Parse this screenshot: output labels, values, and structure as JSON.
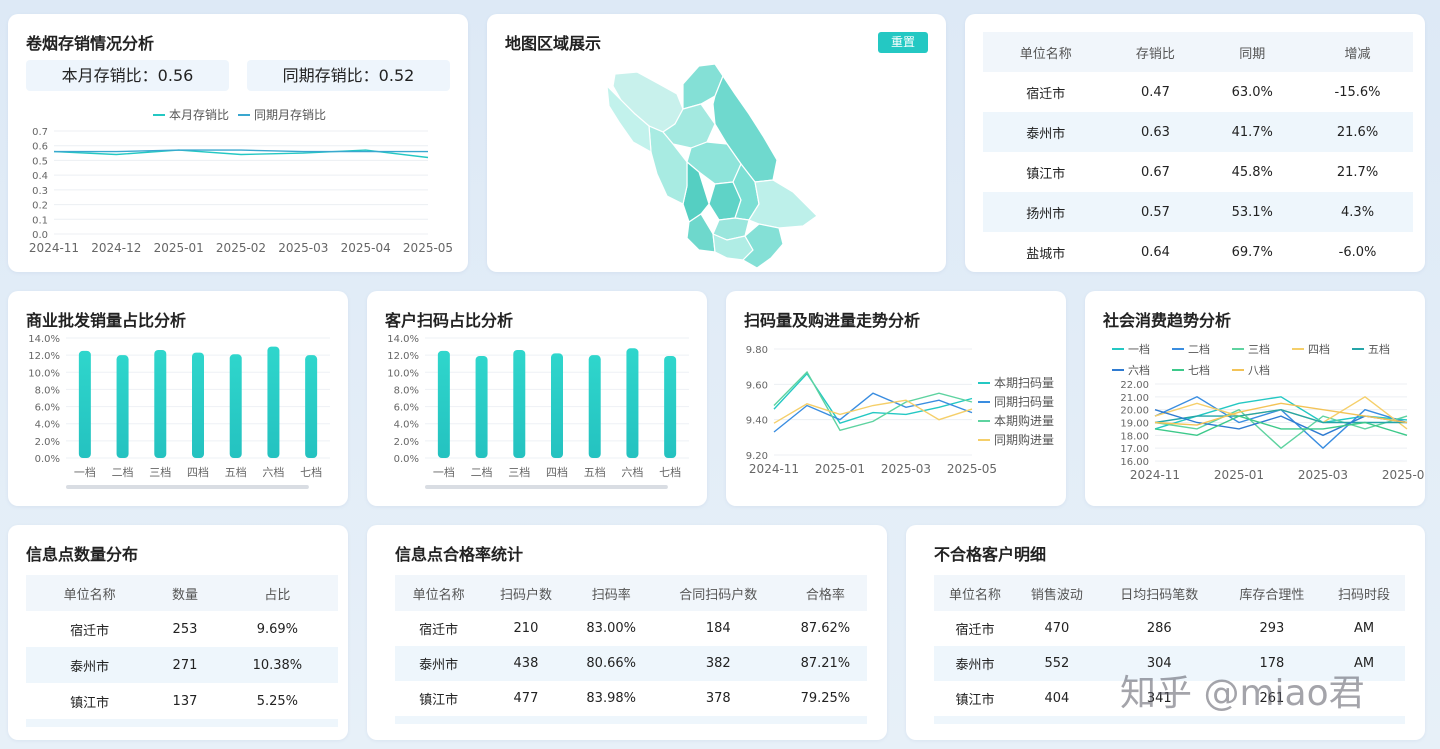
{
  "card1": {
    "title": "卷烟存销情况分析",
    "stat1": "本月存销比：0.56",
    "stat2": "同期存销比：0.52"
  },
  "card2": {
    "title": "地图区域展示",
    "reset": "重置"
  },
  "table_top": {
    "headers": [
      "单位名称",
      "存销比",
      "同期",
      "增减"
    ],
    "rows": [
      [
        "宿迁市",
        "0.47",
        "63.0%",
        "-15.6%"
      ],
      [
        "泰州市",
        "0.63",
        "41.7%",
        "21.6%"
      ],
      [
        "镇江市",
        "0.67",
        "45.8%",
        "21.7%"
      ],
      [
        "扬州市",
        "0.57",
        "53.1%",
        "4.3%"
      ],
      [
        "盐城市",
        "0.64",
        "69.7%",
        "-6.0%"
      ]
    ]
  },
  "card4": {
    "title": "商业批发销量占比分析"
  },
  "card5": {
    "title": "客户扫码占比分析"
  },
  "card6": {
    "title": "扫码量及购进量走势分析"
  },
  "card7": {
    "title": "社会消费趋势分析"
  },
  "card8": {
    "title": "信息点数量分布",
    "headers": [
      "单位名称",
      "数量",
      "占比"
    ],
    "rows": [
      [
        "宿迁市",
        "253",
        "9.69%"
      ],
      [
        "泰州市",
        "271",
        "10.38%"
      ],
      [
        "镇江市",
        "137",
        "5.25%"
      ]
    ]
  },
  "card9": {
    "title": "信息点合格率统计",
    "headers": [
      "单位名称",
      "扫码户数",
      "扫码率",
      "合同扫码户数",
      "合格率"
    ],
    "rows": [
      [
        "宿迁市",
        "210",
        "83.00%",
        "184",
        "87.62%"
      ],
      [
        "泰州市",
        "438",
        "80.66%",
        "382",
        "87.21%"
      ],
      [
        "镇江市",
        "477",
        "83.98%",
        "378",
        "79.25%"
      ]
    ]
  },
  "card10": {
    "title": "不合格客户明细",
    "headers": [
      "单位名称",
      "销售波动",
      "日均扫码笔数",
      "库存合理性",
      "扫码时段"
    ],
    "rows": [
      [
        "宿迁市",
        "470",
        "286",
        "293",
        "AM"
      ],
      [
        "泰州市",
        "552",
        "304",
        "178",
        "AM"
      ],
      [
        "镇江市",
        "404",
        "341",
        "261",
        ""
      ]
    ]
  },
  "watermark": "知乎 @miao君",
  "colors": {
    "teal": "#24c8c3",
    "blue": "#3a8de0",
    "green": "#5ed3a0",
    "yellow": "#f5cf6a"
  },
  "chart_data": [
    {
      "type": "line",
      "x": [
        "2024-11",
        "2024-12",
        "2025-01",
        "2025-02",
        "2025-03",
        "2025-04",
        "2025-05"
      ],
      "series": [
        {
          "name": "本月存销比",
          "values": [
            0.56,
            0.54,
            0.57,
            0.54,
            0.55,
            0.57,
            0.52
          ]
        },
        {
          "name": "同期月存销比",
          "values": [
            0.56,
            0.56,
            0.57,
            0.57,
            0.56,
            0.56,
            0.56
          ]
        }
      ],
      "ylim": [
        0,
        0.7
      ],
      "yticks": [
        "0.7",
        "0.6",
        "0.5",
        "0.4",
        "0.3",
        "0.2",
        "0.1",
        "0.0"
      ]
    },
    {
      "type": "bar",
      "categories": [
        "一档",
        "二档",
        "三档",
        "四档",
        "五档",
        "六档",
        "七档"
      ],
      "values": [
        12.5,
        12.0,
        12.6,
        12.3,
        12.1,
        13.0,
        12.0
      ],
      "ylim": [
        0,
        14
      ],
      "yticks": [
        "14.0%",
        "12.0%",
        "10.0%",
        "8.0%",
        "6.0%",
        "4.0%",
        "2.0%",
        "0.0%"
      ]
    },
    {
      "type": "bar",
      "categories": [
        "一档",
        "二档",
        "三档",
        "四档",
        "五档",
        "六档",
        "七档"
      ],
      "values": [
        12.5,
        11.9,
        12.6,
        12.2,
        12.0,
        12.8,
        11.9
      ],
      "ylim": [
        0,
        14
      ],
      "yticks": [
        "14.0%",
        "12.0%",
        "10.0%",
        "8.0%",
        "6.0%",
        "4.0%",
        "2.0%",
        "0.0%"
      ]
    },
    {
      "type": "line",
      "xticks": [
        "2024-11",
        "2025-01",
        "2025-03",
        "2025-05"
      ],
      "ylim": [
        9.2,
        9.8
      ],
      "yticks": [
        "9.80",
        "9.60",
        "9.40",
        "9.20"
      ],
      "series": [
        {
          "name": "本期扫码量",
          "color": "#24c8c3",
          "values": [
            9.46,
            9.66,
            9.38,
            9.44,
            9.43,
            9.47,
            9.52
          ]
        },
        {
          "name": "同期扫码量",
          "color": "#3a8de0",
          "values": [
            9.33,
            9.48,
            9.4,
            9.55,
            9.47,
            9.51,
            9.44
          ]
        },
        {
          "name": "本期购进量",
          "color": "#5ed3a0",
          "values": [
            9.48,
            9.67,
            9.34,
            9.39,
            9.5,
            9.55,
            9.5
          ]
        },
        {
          "name": "同期购进量",
          "color": "#f5cf6a",
          "values": [
            9.38,
            9.49,
            9.43,
            9.48,
            9.51,
            9.4,
            9.46
          ]
        }
      ]
    },
    {
      "type": "line",
      "xticks": [
        "2024-11",
        "2025-01",
        "2025-03",
        "2025-05"
      ],
      "ylim": [
        16,
        22
      ],
      "yticks": [
        "22.00",
        "21.00",
        "20.00",
        "19.00",
        "18.00",
        "17.00",
        "16.00"
      ],
      "series": [
        {
          "name": "一档",
          "color": "#24c8c3",
          "values": [
            18.5,
            19.5,
            20.5,
            21.0,
            19.0,
            19.5,
            19.2
          ]
        },
        {
          "name": "二档",
          "color": "#3a8de0",
          "values": [
            19.5,
            21.0,
            19.0,
            20.0,
            17.0,
            20.0,
            19.0
          ]
        },
        {
          "name": "三档",
          "color": "#5ed3a0",
          "values": [
            19.0,
            18.5,
            20.0,
            17.0,
            19.5,
            18.5,
            19.5
          ]
        },
        {
          "name": "四档",
          "color": "#f5cf6a",
          "values": [
            19.5,
            20.5,
            19.5,
            20.0,
            19.0,
            21.0,
            18.5
          ]
        },
        {
          "name": "五档",
          "color": "#24a5a8",
          "values": [
            19.0,
            19.5,
            19.5,
            20.0,
            19.0,
            19.0,
            19.0
          ]
        },
        {
          "name": "六档",
          "color": "#2f7bd1",
          "values": [
            20.0,
            19.0,
            18.5,
            19.5,
            18.0,
            19.5,
            19.0
          ]
        },
        {
          "name": "七档",
          "color": "#3cc98a",
          "values": [
            18.5,
            18.0,
            19.5,
            18.5,
            18.5,
            19.0,
            18.0
          ]
        },
        {
          "name": "八档",
          "color": "#f3c357",
          "values": [
            19.0,
            18.8,
            19.8,
            20.5,
            20.0,
            19.5,
            19.0
          ]
        }
      ]
    }
  ]
}
